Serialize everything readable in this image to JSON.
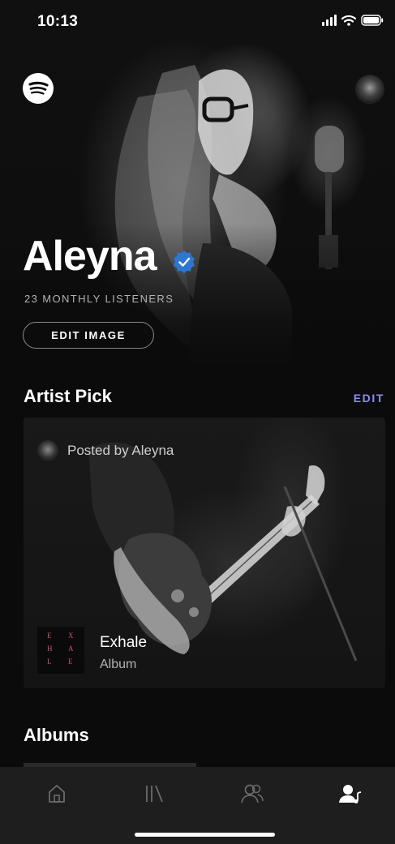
{
  "status_bar": {
    "time": "10:13"
  },
  "artist": {
    "name": "Aleyna",
    "listeners": "23 MONTHLY LISTENERS",
    "edit_image_label": "EDIT IMAGE"
  },
  "artist_pick": {
    "title": "Artist Pick",
    "edit_label": "EDIT",
    "posted_by": "Posted by Aleyna",
    "album_name": "Exhale",
    "album_type": "Album",
    "cover_letters": [
      "E",
      "X",
      "H",
      "A",
      "L",
      "E"
    ]
  },
  "albums": {
    "title": "Albums"
  },
  "nav": {
    "items": [
      {
        "name": "home-icon",
        "active": false
      },
      {
        "name": "library-icon",
        "active": false
      },
      {
        "name": "friends-icon",
        "active": false
      },
      {
        "name": "artist-profile-icon",
        "active": true
      }
    ]
  },
  "colors": {
    "accent_edit": "#8c8df5",
    "verified": "#2e77d0",
    "background": "#0b0b0b",
    "nav_background": "#1e1e1e"
  }
}
